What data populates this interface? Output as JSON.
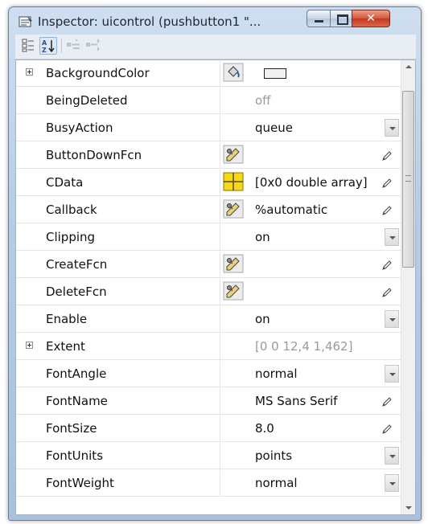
{
  "window": {
    "title": "Inspector: uicontrol (pushbutton1 \"..."
  },
  "toolbar": {
    "buttons": [
      {
        "name": "categorized-view",
        "icon": "categorized-icon"
      },
      {
        "name": "alphabetical-sort",
        "icon": "sort-az-icon",
        "active": true
      },
      {
        "name": "expand-all",
        "icon": "expand-all-icon"
      },
      {
        "name": "collapse-all",
        "icon": "collapse-all-icon"
      }
    ]
  },
  "properties": [
    {
      "name": "BackgroundColor",
      "expandable": true,
      "icon": "paint-bucket-icon",
      "value": "",
      "widget": "color"
    },
    {
      "name": "BeingDeleted",
      "value": "off",
      "dim": true
    },
    {
      "name": "BusyAction",
      "value": "queue",
      "widget": "dropdown"
    },
    {
      "name": "ButtonDownFcn",
      "icon": "edit-callback-icon",
      "value": "",
      "widget": "pencil"
    },
    {
      "name": "CData",
      "icon": "array-grid-icon",
      "value": "[0x0  double array]",
      "widget": "pencil"
    },
    {
      "name": "Callback",
      "icon": "edit-callback-icon",
      "value": "%automatic",
      "widget": "pencil"
    },
    {
      "name": "Clipping",
      "value": "on",
      "widget": "dropdown"
    },
    {
      "name": "CreateFcn",
      "icon": "edit-callback-icon",
      "value": "",
      "widget": "pencil"
    },
    {
      "name": "DeleteFcn",
      "icon": "edit-callback-icon",
      "value": "",
      "widget": "pencil"
    },
    {
      "name": "Enable",
      "value": "on",
      "widget": "dropdown"
    },
    {
      "name": "Extent",
      "expandable": true,
      "value": "[0 0 12,4 1,462]",
      "dim": true
    },
    {
      "name": "FontAngle",
      "value": "normal",
      "widget": "dropdown"
    },
    {
      "name": "FontName",
      "value": "MS Sans Serif",
      "widget": "pencil"
    },
    {
      "name": "FontSize",
      "value": "8.0",
      "widget": "pencil"
    },
    {
      "name": "FontUnits",
      "value": "points",
      "widget": "dropdown"
    },
    {
      "name": "FontWeight",
      "value": "normal",
      "widget": "dropdown"
    }
  ],
  "colors": {
    "titlebar": "#b7cde6",
    "close": "#c2391f",
    "grid_line": "#e5e5e5"
  }
}
